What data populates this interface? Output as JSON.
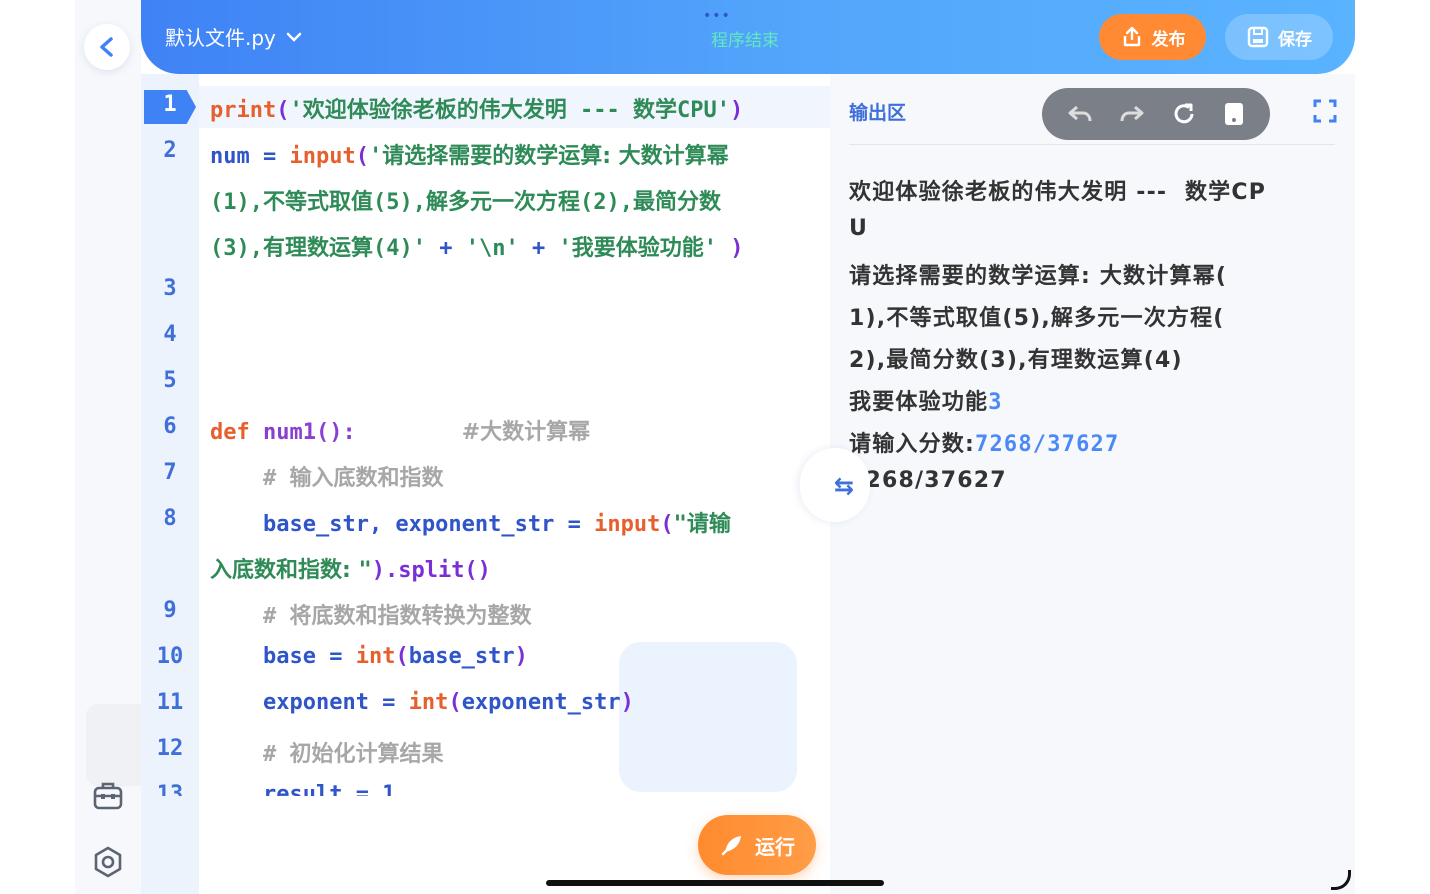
{
  "header": {
    "file_name": "默认文件.py",
    "status": "程序结束",
    "dots": "•••",
    "publish_label": "发布",
    "save_label": "保存"
  },
  "editor": {
    "line_numbers": [
      "1",
      "2",
      "3",
      "4",
      "5",
      "6",
      "7",
      "8",
      "9",
      "10",
      "11",
      "12",
      "13"
    ],
    "lines": [
      {
        "num": "1",
        "code": "print('欢迎体验徐老板的伟大发明 --- 数学CPU')"
      },
      {
        "num": "2",
        "code": "num = input('请选择需要的数学运算: 大数计算幂"
      },
      {
        "num": "",
        "code": "(1),不等式取值(5),解多元一次方程(2),最简分数"
      },
      {
        "num": "",
        "code": "(3),有理数运算(4)' + '\\n' + '我要体验功能' )"
      },
      {
        "num": "6",
        "code": "def num1():         #大数计算幂"
      },
      {
        "num": "7",
        "code": "    # 输入底数和指数"
      },
      {
        "num": "8",
        "code": "    base_str, exponent_str = input(\"请输"
      },
      {
        "num": "",
        "code": "入底数和指数: \").split()"
      },
      {
        "num": "9",
        "code": "    # 将底数和指数转换为整数"
      },
      {
        "num": "10",
        "code": "    base = int(base_str)"
      },
      {
        "num": "11",
        "code": "    exponent = int(exponent_str)"
      },
      {
        "num": "12",
        "code": "    # 初始化计算结果"
      },
      {
        "num": "13",
        "code": "    result = 1"
      }
    ]
  },
  "run_label": "运行",
  "output": {
    "title": "输出区",
    "lines": [
      {
        "text": "欢迎体验徐老板的伟大发明 ---  数学CP"
      },
      {
        "text": "U"
      },
      {
        "text": "请选择需要的数学运算: 大数计算幂("
      },
      {
        "text": "1),不等式取值(5),解多元一次方程("
      },
      {
        "text": "2),最简分数(3),有理数运算(4)"
      },
      {
        "text": "我要体验功能",
        "input": "3"
      },
      {
        "text": "请输入分数:",
        "input": "7268/37627"
      },
      {
        "text": "7268/37627"
      }
    ]
  }
}
